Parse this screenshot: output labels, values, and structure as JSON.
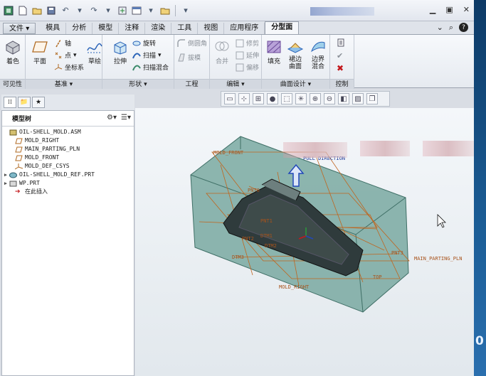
{
  "quick_access": {
    "icons": [
      "app-icon",
      "new-icon",
      "open-icon",
      "save-icon",
      "undo-icon",
      "redo-icon",
      "regenerate-icon",
      "windows-icon",
      "close-window-icon",
      "more-icon"
    ]
  },
  "window_controls": {
    "minimize": "▁",
    "restore": "▣",
    "close": "✕"
  },
  "tabs": [
    {
      "label": "文件",
      "dropdown": "▾"
    },
    {
      "label": "模具"
    },
    {
      "label": "分析"
    },
    {
      "label": "模型"
    },
    {
      "label": "注释"
    },
    {
      "label": "渲染"
    },
    {
      "label": "工具"
    },
    {
      "label": "视图"
    },
    {
      "label": "应用程序"
    },
    {
      "label": "分型面",
      "active": true
    }
  ],
  "tab_right": {
    "help_a": "⌄",
    "search": "⌕",
    "help": "?"
  },
  "ribbon": {
    "visibility": {
      "shade": "着色",
      "group": "可见性"
    },
    "datum": {
      "plane": "平面",
      "axis": "轴",
      "point": "点",
      "csys": "坐标系",
      "group": "基准",
      "dropdown": "▾"
    },
    "shape": {
      "sketch": "草绘",
      "extrude": "拉伸",
      "revolve": "旋转",
      "sweep": "扫描",
      "swept_blend": "扫描混合",
      "group": "形状",
      "dropdown": "▾"
    },
    "engineering": {
      "round": "倒圆角",
      "draft": "拔模",
      "group": "工程"
    },
    "editing": {
      "merge": "合并",
      "trim": "修剪",
      "extend": "延伸",
      "offset": "偏移",
      "group": "编辑",
      "dropdown": "▾"
    },
    "surface_design": {
      "fill": "填充",
      "boundary_surface": "裙边曲面",
      "boundary_blend": "边界混合",
      "group": "曲面设计",
      "dropdown": "▾"
    },
    "control": {
      "group": "控制"
    }
  },
  "model_tree": {
    "title": "模型树",
    "rows": [
      {
        "label": "OIL-SHELL_MOLD.ASM",
        "icon": "assembly-icon",
        "expand": ""
      },
      {
        "label": "MOLD_RIGHT",
        "icon": "datum-plane-icon",
        "expand": ""
      },
      {
        "label": "MAIN_PARTING_PLN",
        "icon": "datum-plane-icon",
        "expand": ""
      },
      {
        "label": "MOLD_FRONT",
        "icon": "datum-plane-icon",
        "expand": ""
      },
      {
        "label": "MOLD_DEF_CSYS",
        "icon": "csys-icon",
        "expand": ""
      },
      {
        "label": "OIL-SHELL_MOLD_REF.PRT",
        "icon": "part-icon",
        "expand": "▶"
      },
      {
        "label": "WP.PRT",
        "icon": "part-icon",
        "expand": "▶"
      },
      {
        "label": "在此插入",
        "icon": "insert-arrow-icon",
        "expand": ""
      }
    ]
  },
  "viewport_labels": {
    "mold_front": "MOLD_FRONT",
    "pull_direction": "PULL DIRECTION",
    "main_parting_pln": "MAIN_PARTING_PLN",
    "mold_right": "MOLD_RIGHT",
    "pnt0": "PNT0",
    "pnt1": "PNT1",
    "pnt2": "PNT2",
    "dtm1": "DTM1",
    "dtm2": "DTM2",
    "dtm3": "DTM3",
    "pnt3": "PNT3",
    "top": "TOP"
  },
  "colors": {
    "ribbon_bg": "#eef1f5",
    "mold_fill": "#6fa39a",
    "datum_orange": "#c0651e",
    "pull_blue": "#2148b8"
  }
}
